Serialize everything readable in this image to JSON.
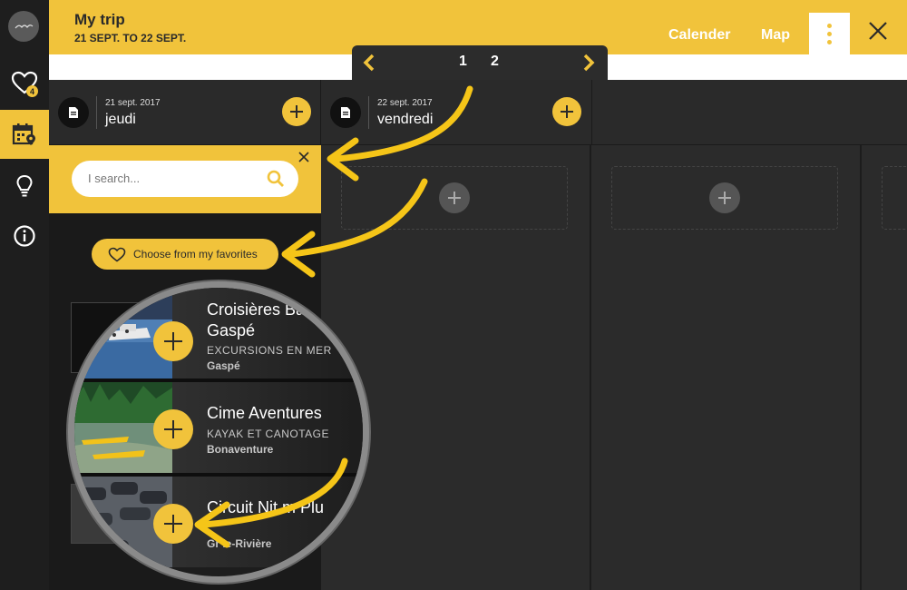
{
  "header": {
    "title": "My trip",
    "dates": "21 SEPT. TO 22 SEPT.",
    "calendar_label": "Calender",
    "map_label": "Map"
  },
  "sidebar": {
    "favorites_count": "4",
    "icons": [
      "heart-icon",
      "calendar-pin-icon",
      "lightbulb-icon",
      "info-icon"
    ]
  },
  "pager": {
    "pages": [
      "1",
      "2"
    ]
  },
  "days": [
    {
      "date": "21 sept. 2017",
      "name": "jeudi"
    },
    {
      "date": "22 sept. 2017",
      "name": "vendredi"
    }
  ],
  "search": {
    "placeholder": "I search..."
  },
  "favorites_button": "Choose from my favorites",
  "activities": [
    {
      "name": "Croisières Ba",
      "name_line2": "Gaspé",
      "category": "EXCURSIONS EN MER",
      "location": "Gaspé"
    },
    {
      "name": "Cime Aventures",
      "category": "KAYAK ET CANOTAGE",
      "location": "Bonaventure"
    },
    {
      "name": "Circuit Nit  m Plu",
      "category": "",
      "location": "Gr   le-Rivière"
    }
  ],
  "colors": {
    "accent": "#f1c33b",
    "dark": "#2a2a2a",
    "rail": "#1e1e1e"
  }
}
